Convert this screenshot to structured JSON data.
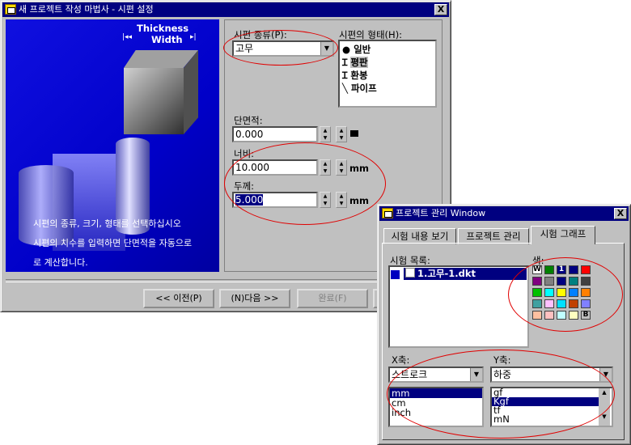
{
  "wizard": {
    "title": "새 프로젝트 작성 마법사 - 시편 설정",
    "close": "X",
    "illustration": {
      "thickness_label": "Thickness",
      "width_label": "Width",
      "desc_line1": "시편의 종류, 크기, 형태를 선택하십시오",
      "desc_line2": "시편의 치수를 입력하면 단면적을 자동으로",
      "desc_line3": "로 계산합니다."
    },
    "specimen_type": {
      "label": "시편 종류(P):",
      "value": "고무"
    },
    "specimen_shape": {
      "label": "시편의 형태(H):",
      "items": [
        "일반",
        "평판",
        "환봉",
        "파이프"
      ]
    },
    "area": {
      "label": "단면적:",
      "value": "0.000"
    },
    "width": {
      "label": "너비:",
      "value": "10.000",
      "unit": "mm"
    },
    "thickness": {
      "label": "두께:",
      "value": "5.000",
      "unit": "mm"
    },
    "buttons": {
      "prev": "<< 이전(P)",
      "next": "(N)다음 >>",
      "finish": "완료(F)"
    }
  },
  "project_window": {
    "title": "프로젝트 관리 Window",
    "close": "X",
    "tabs": [
      "시험 내용 보기",
      "프로젝트 관리",
      "시험 그래프"
    ],
    "test_list_label": "시험 목록:",
    "test_items": [
      "1.고무-1.dkt"
    ],
    "color_label": "색:",
    "palette_row1": [
      "#ffffff",
      "#008000",
      "#000080",
      "#000080",
      "#ff0000"
    ],
    "palette_row1_labels": [
      "W",
      "",
      "1",
      "",
      ""
    ],
    "palette_row2": [
      "#800080",
      "#808080",
      "#000080",
      "#008080",
      "#404040"
    ],
    "palette_row3": [
      "#00c000",
      "#00ffff",
      "#ffff00",
      "#0080ff",
      "#ff8000"
    ],
    "palette_row4": [
      "#40a0a0",
      "#ffc0ff",
      "#00e0ff",
      "#c04000",
      "#8080ff"
    ],
    "palette_row5": [
      "#ffc0a0",
      "#ffc0c0",
      "#c0ffff",
      "#ffffc0",
      "#c0c0c0"
    ],
    "palette_row5_labels": [
      "",
      "",
      "",
      "",
      "B"
    ],
    "xaxis": {
      "label": "X축:",
      "value": "스트로크",
      "units": [
        "mm",
        "cm",
        "inch"
      ]
    },
    "yaxis": {
      "label": "Y축:",
      "value": "하중",
      "units": [
        "gf",
        "Kgf",
        "tf",
        "mN"
      ]
    }
  }
}
